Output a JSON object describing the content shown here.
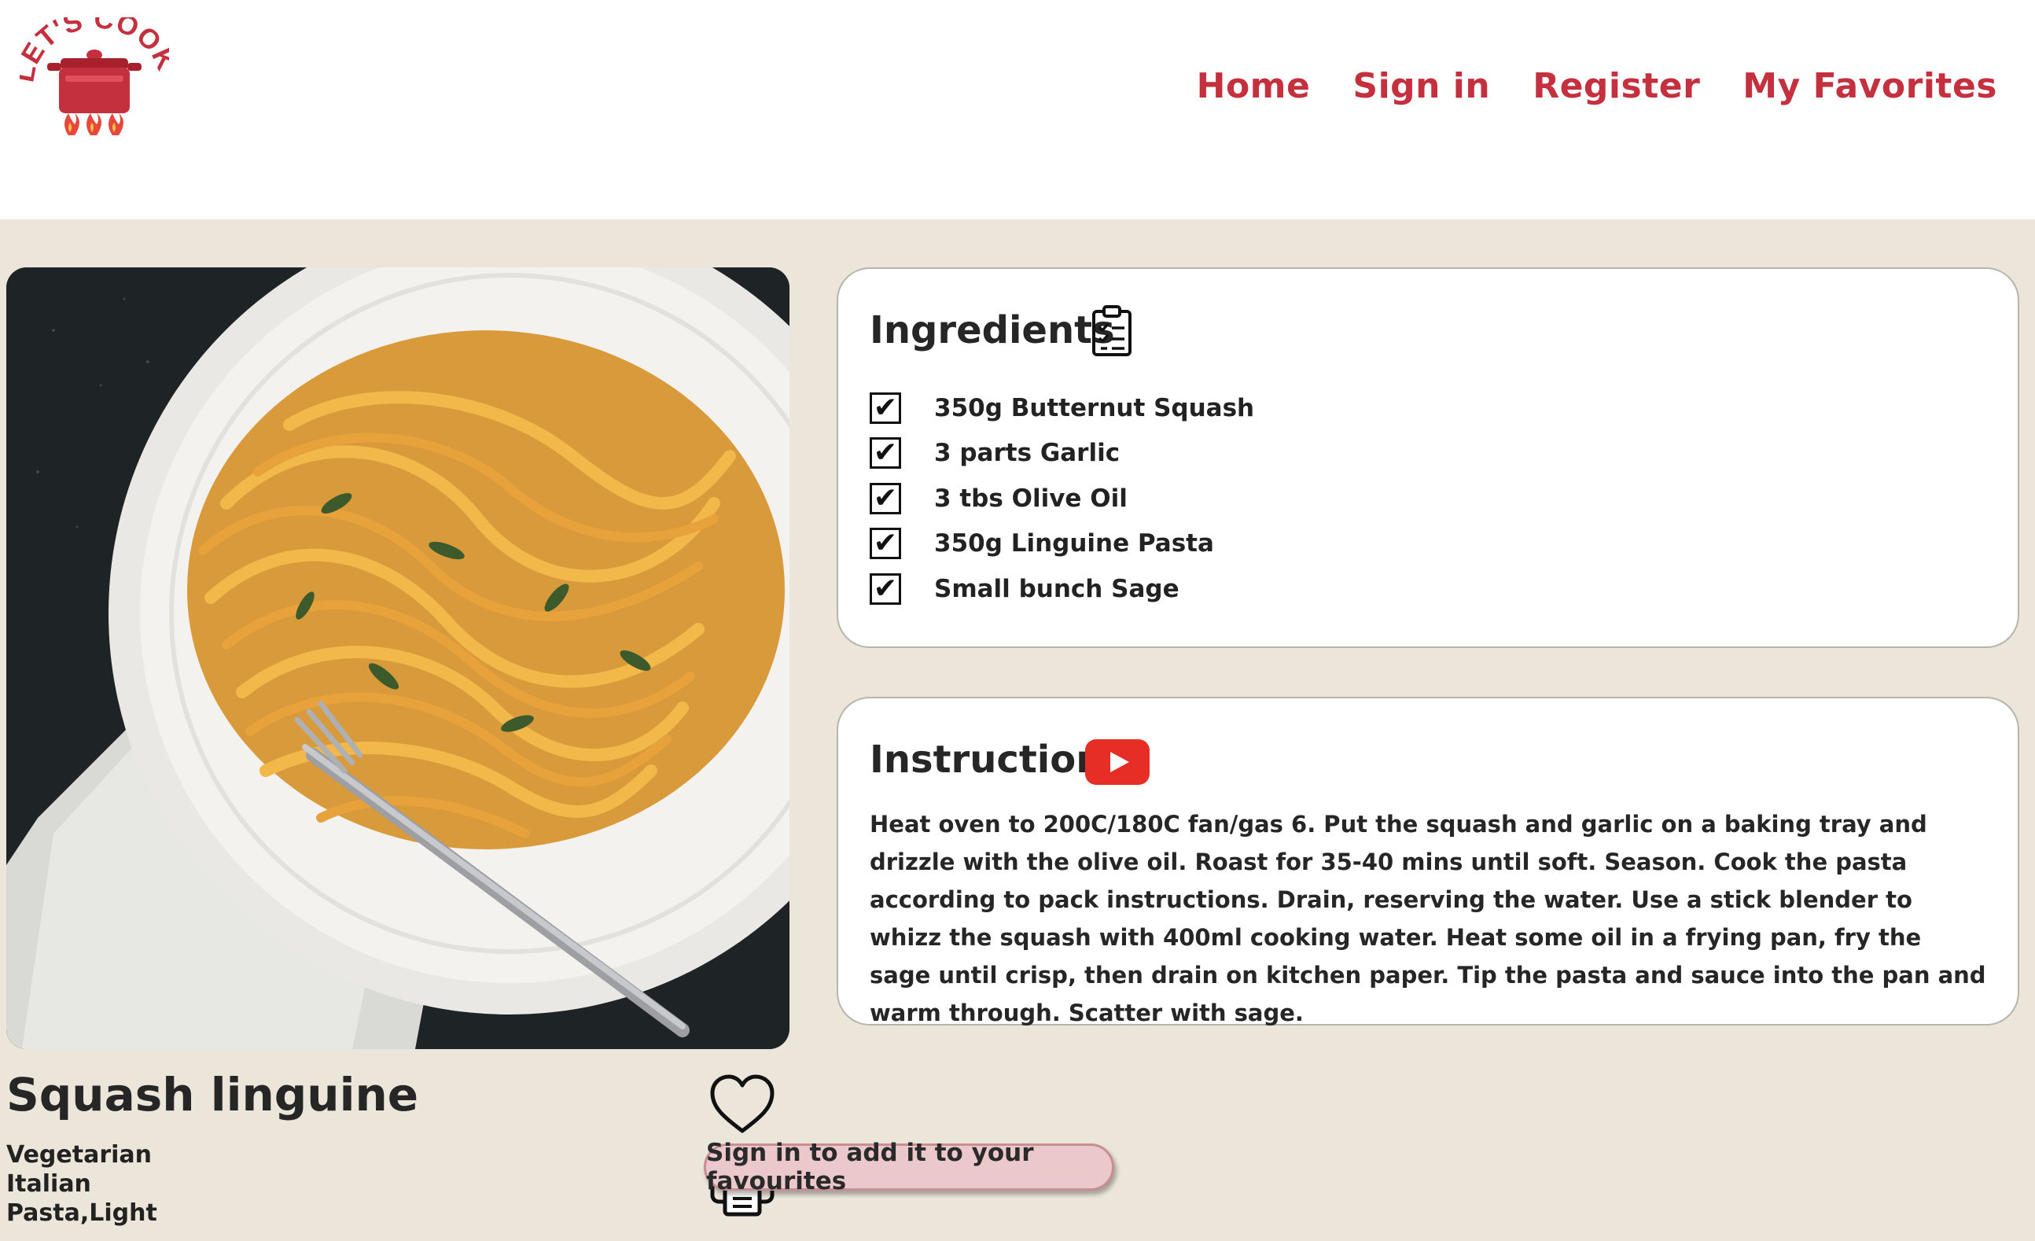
{
  "header": {
    "logo_text": "LET'S COOK",
    "nav": [
      {
        "label": "Home"
      },
      {
        "label": "Sign in"
      },
      {
        "label": "Register"
      },
      {
        "label": "My Favorites"
      }
    ]
  },
  "recipe": {
    "title": "Squash linguine",
    "tags": [
      "Vegetarian",
      "Italian",
      "Pasta,Light"
    ],
    "favourite_tooltip": "Sign in to add it to your favourites"
  },
  "ingredients": {
    "heading": "Ingredients",
    "items": [
      {
        "text": "350g Butternut Squash",
        "checked": true
      },
      {
        "text": "3 parts Garlic",
        "checked": true
      },
      {
        "text": "3 tbs Olive Oil",
        "checked": true
      },
      {
        "text": "350g Linguine Pasta",
        "checked": true
      },
      {
        "text": "Small bunch Sage",
        "checked": true
      }
    ],
    "check_glyph": "✔"
  },
  "instruction": {
    "heading": "Instruction",
    "text": "Heat oven to 200C/180C fan/gas 6. Put the squash and garlic on a baking tray and drizzle with the olive oil. Roast for 35-40 mins until soft. Season. Cook the pasta according to pack instructions. Drain, reserving the water. Use a stick blender to whizz the squash with 400ml cooking water. Heat some oil in a frying pan, fry the sage until crisp, then drain on kitchen paper. Tip the pasta and sauce into the pan and warm through. Scatter with sage."
  },
  "colors": {
    "brand": "#c5303e",
    "background": "#ebe5da",
    "tooltip_bg": "#ebc8cc",
    "youtube": "#e62d26"
  },
  "icons": {
    "logo": "cooking-pot-logo",
    "ingredients": "clipboard-checklist-icon",
    "instruction": "youtube-play-icon",
    "favourite": "heart-outline-icon",
    "print": "printer-icon"
  }
}
